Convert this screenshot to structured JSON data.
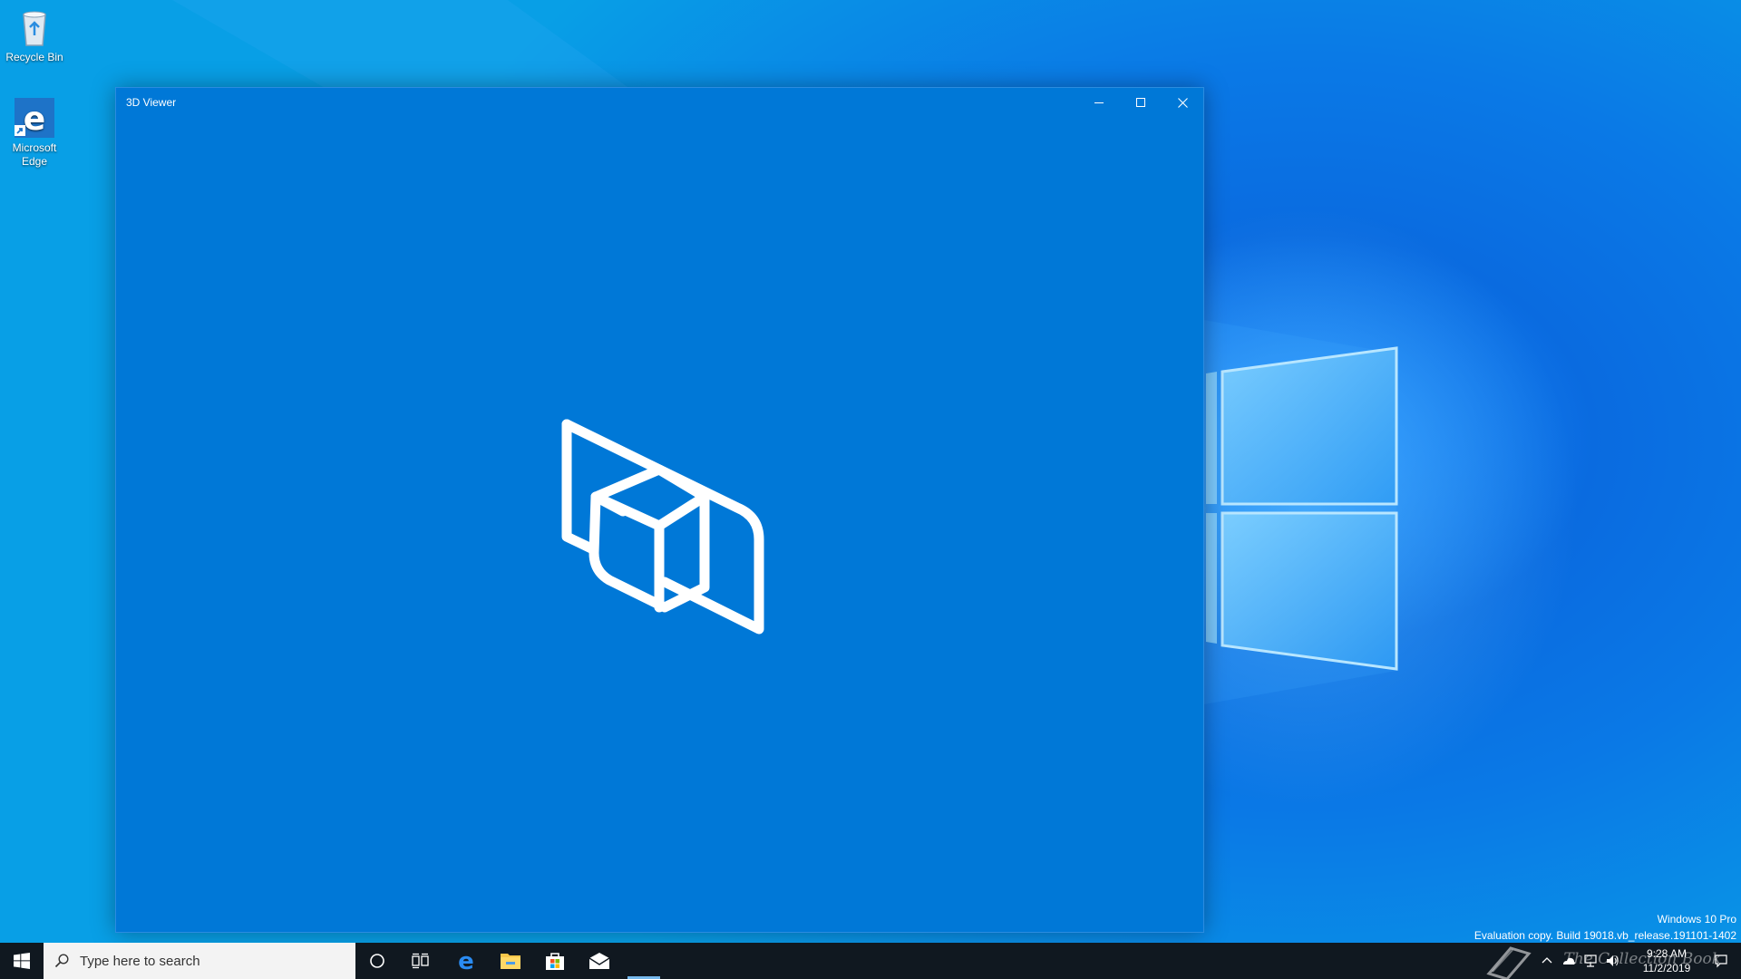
{
  "desktop": {
    "icons": [
      {
        "label": "Recycle Bin",
        "icon": "recycle-bin-icon"
      },
      {
        "label": "Microsoft Edge",
        "icon": "edge-icon"
      }
    ],
    "watermark": {
      "edition": "Windows 10 Pro",
      "build": "Evaluation copy. Build 19018.vb_release.191101-1402"
    }
  },
  "window": {
    "title": "3D Viewer",
    "background": "#0078d7",
    "controls": [
      "minimize-icon",
      "maximize-icon",
      "close-icon"
    ],
    "splash_icon": "3d-viewer-logo"
  },
  "taskbar": {
    "search_placeholder": "Type here to search",
    "pinned": [
      "cortana-icon",
      "task-view-icon",
      "edge-icon",
      "file-explorer-icon",
      "store-icon",
      "mail-icon"
    ],
    "tray": {
      "time": "9:28 AM",
      "date": "11/2/2019",
      "overlay_text": "The Collection Book"
    }
  }
}
